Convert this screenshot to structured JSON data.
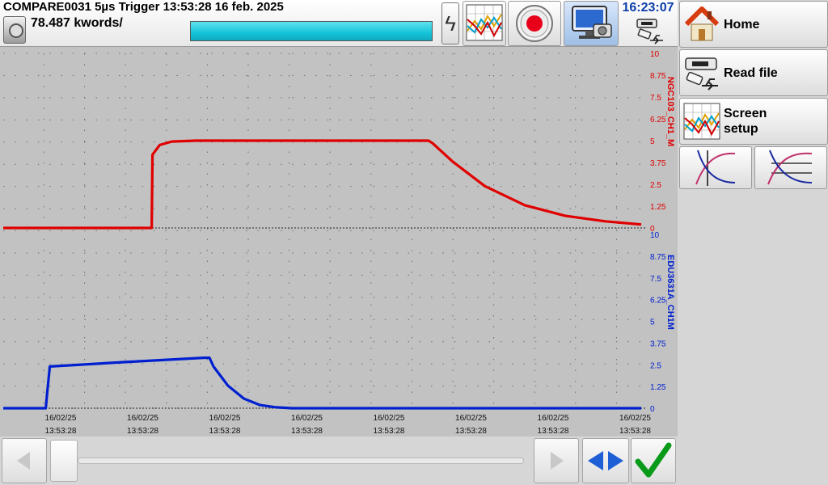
{
  "header": {
    "title": "COMPARE0031  5µs  Trigger 13:53:28 16 feb. 2025",
    "kwords": "78.487 kwords/",
    "clock": "16:23:07",
    "progress": 1.0
  },
  "sidebar": {
    "home_label": "Home",
    "read_file_label": "Read file",
    "screen_setup_line1": "Screen",
    "screen_setup_line2": "setup"
  },
  "colors": {
    "channel1": "#e00000",
    "channel2": "#0020d0",
    "plot_background": "#c2c2c2",
    "accent_clock": "#0a3fa8"
  },
  "chart_data": {
    "type": "line",
    "x_tick_labels": [
      {
        "date": "16/02/25",
        "time": "13:53:28"
      },
      {
        "date": "16/02/25",
        "time": "13:53:28"
      },
      {
        "date": "16/02/25",
        "time": "13:53:28"
      },
      {
        "date": "16/02/25",
        "time": "13:53:28"
      },
      {
        "date": "16/02/25",
        "time": "13:53:28"
      },
      {
        "date": "16/02/25",
        "time": "13:53:28"
      },
      {
        "date": "16/02/25",
        "time": "13:53:28"
      },
      {
        "date": "16/02/25",
        "time": "13:53:28"
      }
    ],
    "x_divisions": 8,
    "grid": true,
    "channels": [
      {
        "name": "NGC103_CH1_M",
        "color": "#e00000",
        "ylim": [
          0,
          10
        ],
        "y_ticks": [
          "10",
          "8.75",
          "7.5",
          "6.25",
          "5",
          "3.75",
          "2.5",
          "1.25",
          "0"
        ],
        "points": [
          [
            0,
            0
          ],
          [
            1.85,
            0
          ],
          [
            1.86,
            4.2
          ],
          [
            1.95,
            4.75
          ],
          [
            2.1,
            4.95
          ],
          [
            2.4,
            5
          ],
          [
            5.3,
            5
          ],
          [
            5.35,
            4.85
          ],
          [
            5.6,
            3.8
          ],
          [
            6.0,
            2.4
          ],
          [
            6.5,
            1.3
          ],
          [
            7.0,
            0.7
          ],
          [
            7.5,
            0.38
          ],
          [
            7.95,
            0.2
          ]
        ]
      },
      {
        "name": "EDU3631A_CH1M",
        "color": "#0020d0",
        "ylim": [
          0,
          10
        ],
        "y_ticks": [
          "10",
          "8.75",
          "7.5",
          "6.25",
          "5",
          "3.75",
          "2.5",
          "1.25",
          "0"
        ],
        "points": [
          [
            0,
            0
          ],
          [
            0.53,
            0
          ],
          [
            0.55,
            1.0
          ],
          [
            0.58,
            2.4
          ],
          [
            1.5,
            2.65
          ],
          [
            2.5,
            2.9
          ],
          [
            2.57,
            2.9
          ],
          [
            2.62,
            2.4
          ],
          [
            2.8,
            1.3
          ],
          [
            3.0,
            0.55
          ],
          [
            3.2,
            0.18
          ],
          [
            3.4,
            0.05
          ],
          [
            3.6,
            0
          ],
          [
            7.95,
            0
          ]
        ]
      }
    ]
  }
}
